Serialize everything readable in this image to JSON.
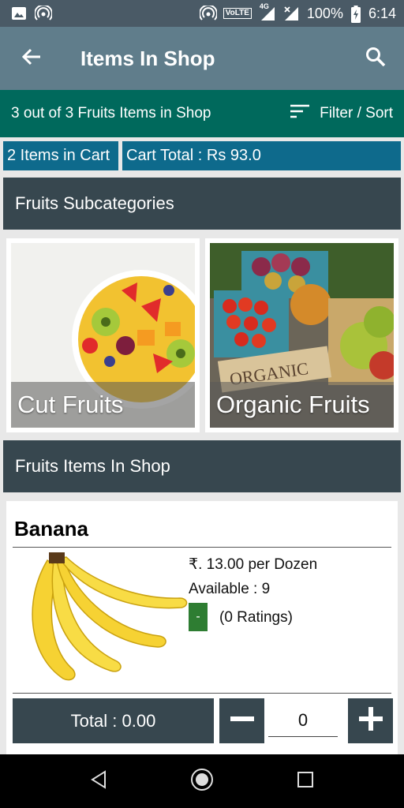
{
  "status_bar": {
    "battery": "100%",
    "time": "6:14",
    "network": "4G",
    "volte": "VoLTE"
  },
  "app_bar": {
    "title": "Items In Shop",
    "back_icon": "arrow-back-icon",
    "search_icon": "search-icon"
  },
  "info_bar": {
    "summary": "3 out of 3 Fruits Items in Shop",
    "filter_label": "Filter / Sort"
  },
  "cart": {
    "count_label": "2 Items in Cart",
    "total_label": "Cart Total : Rs 93.0"
  },
  "subcategories": {
    "header": "Fruits Subcategories",
    "items": [
      {
        "label": "Cut Fruits"
      },
      {
        "label": "Organic Fruits"
      }
    ]
  },
  "items_section": {
    "header": "Fruits Items In Shop"
  },
  "products": [
    {
      "name": "Banana",
      "price": "₹. 13.00 per Dozen",
      "availability": "Available : 9",
      "rating_badge": "-",
      "ratings": "(0 Ratings)",
      "total": "Total : 0.00",
      "quantity": "0"
    }
  ],
  "sign_text": "ORGANIC",
  "colors": {
    "status_bar": "#4a5a66",
    "app_bar": "#607d8b",
    "info_bar": "#00695c",
    "cart_bar": "#0e6a8c",
    "section_header": "#37474f",
    "rating_badge": "#2e7d32"
  }
}
